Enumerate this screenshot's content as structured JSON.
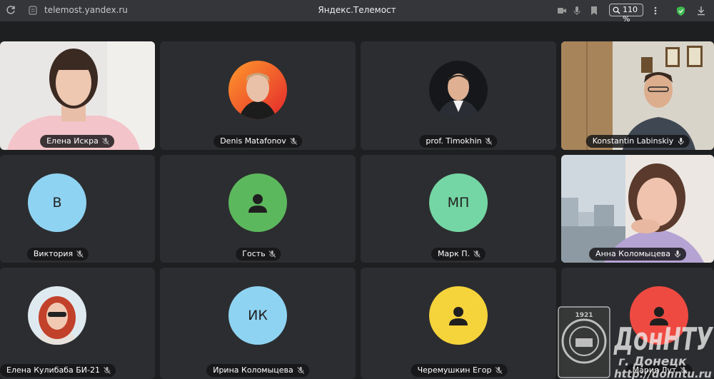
{
  "browser": {
    "url": "telemost.yandex.ru",
    "page_title": "Яндекс.Телемост",
    "zoom": "110 %"
  },
  "participants": [
    {
      "name": "Елена Искра",
      "type": "video",
      "mic": "muted"
    },
    {
      "name": "Denis Matafonov",
      "type": "photo",
      "mic": "muted"
    },
    {
      "name": "prof. Timokhin",
      "type": "photo",
      "mic": "muted"
    },
    {
      "name": "Konstantin Labinskiy",
      "type": "video",
      "mic": "on",
      "speaking": true
    },
    {
      "name": "Виктория",
      "type": "initials",
      "initials": "В",
      "color": "#8fd3f2",
      "mic": "muted"
    },
    {
      "name": "Гость",
      "type": "guest",
      "color": "#5cb85c",
      "mic": "muted"
    },
    {
      "name": "Марк П.",
      "type": "initials",
      "initials": "МП",
      "color": "#74d6a4",
      "mic": "muted"
    },
    {
      "name": "Анна Коломыцева",
      "type": "video",
      "mic": "on"
    },
    {
      "name": "Елена Кулибаба БИ-21",
      "type": "photo",
      "mic": "muted"
    },
    {
      "name": "Ирина Коломыцева",
      "type": "initials",
      "initials": "ИК",
      "color": "#8fd3f2",
      "mic": "muted"
    },
    {
      "name": "Черемушкин Егор",
      "type": "guest",
      "color": "#f5d33a",
      "mic": "muted"
    },
    {
      "name": "Мария Лут",
      "type": "guest",
      "color": "#ef4a41",
      "mic": "muted"
    }
  ],
  "watermark": {
    "title": "ДонНТУ",
    "city": "г. Донецк",
    "url": "http://donntu.ru",
    "logo_caption": "1921"
  }
}
